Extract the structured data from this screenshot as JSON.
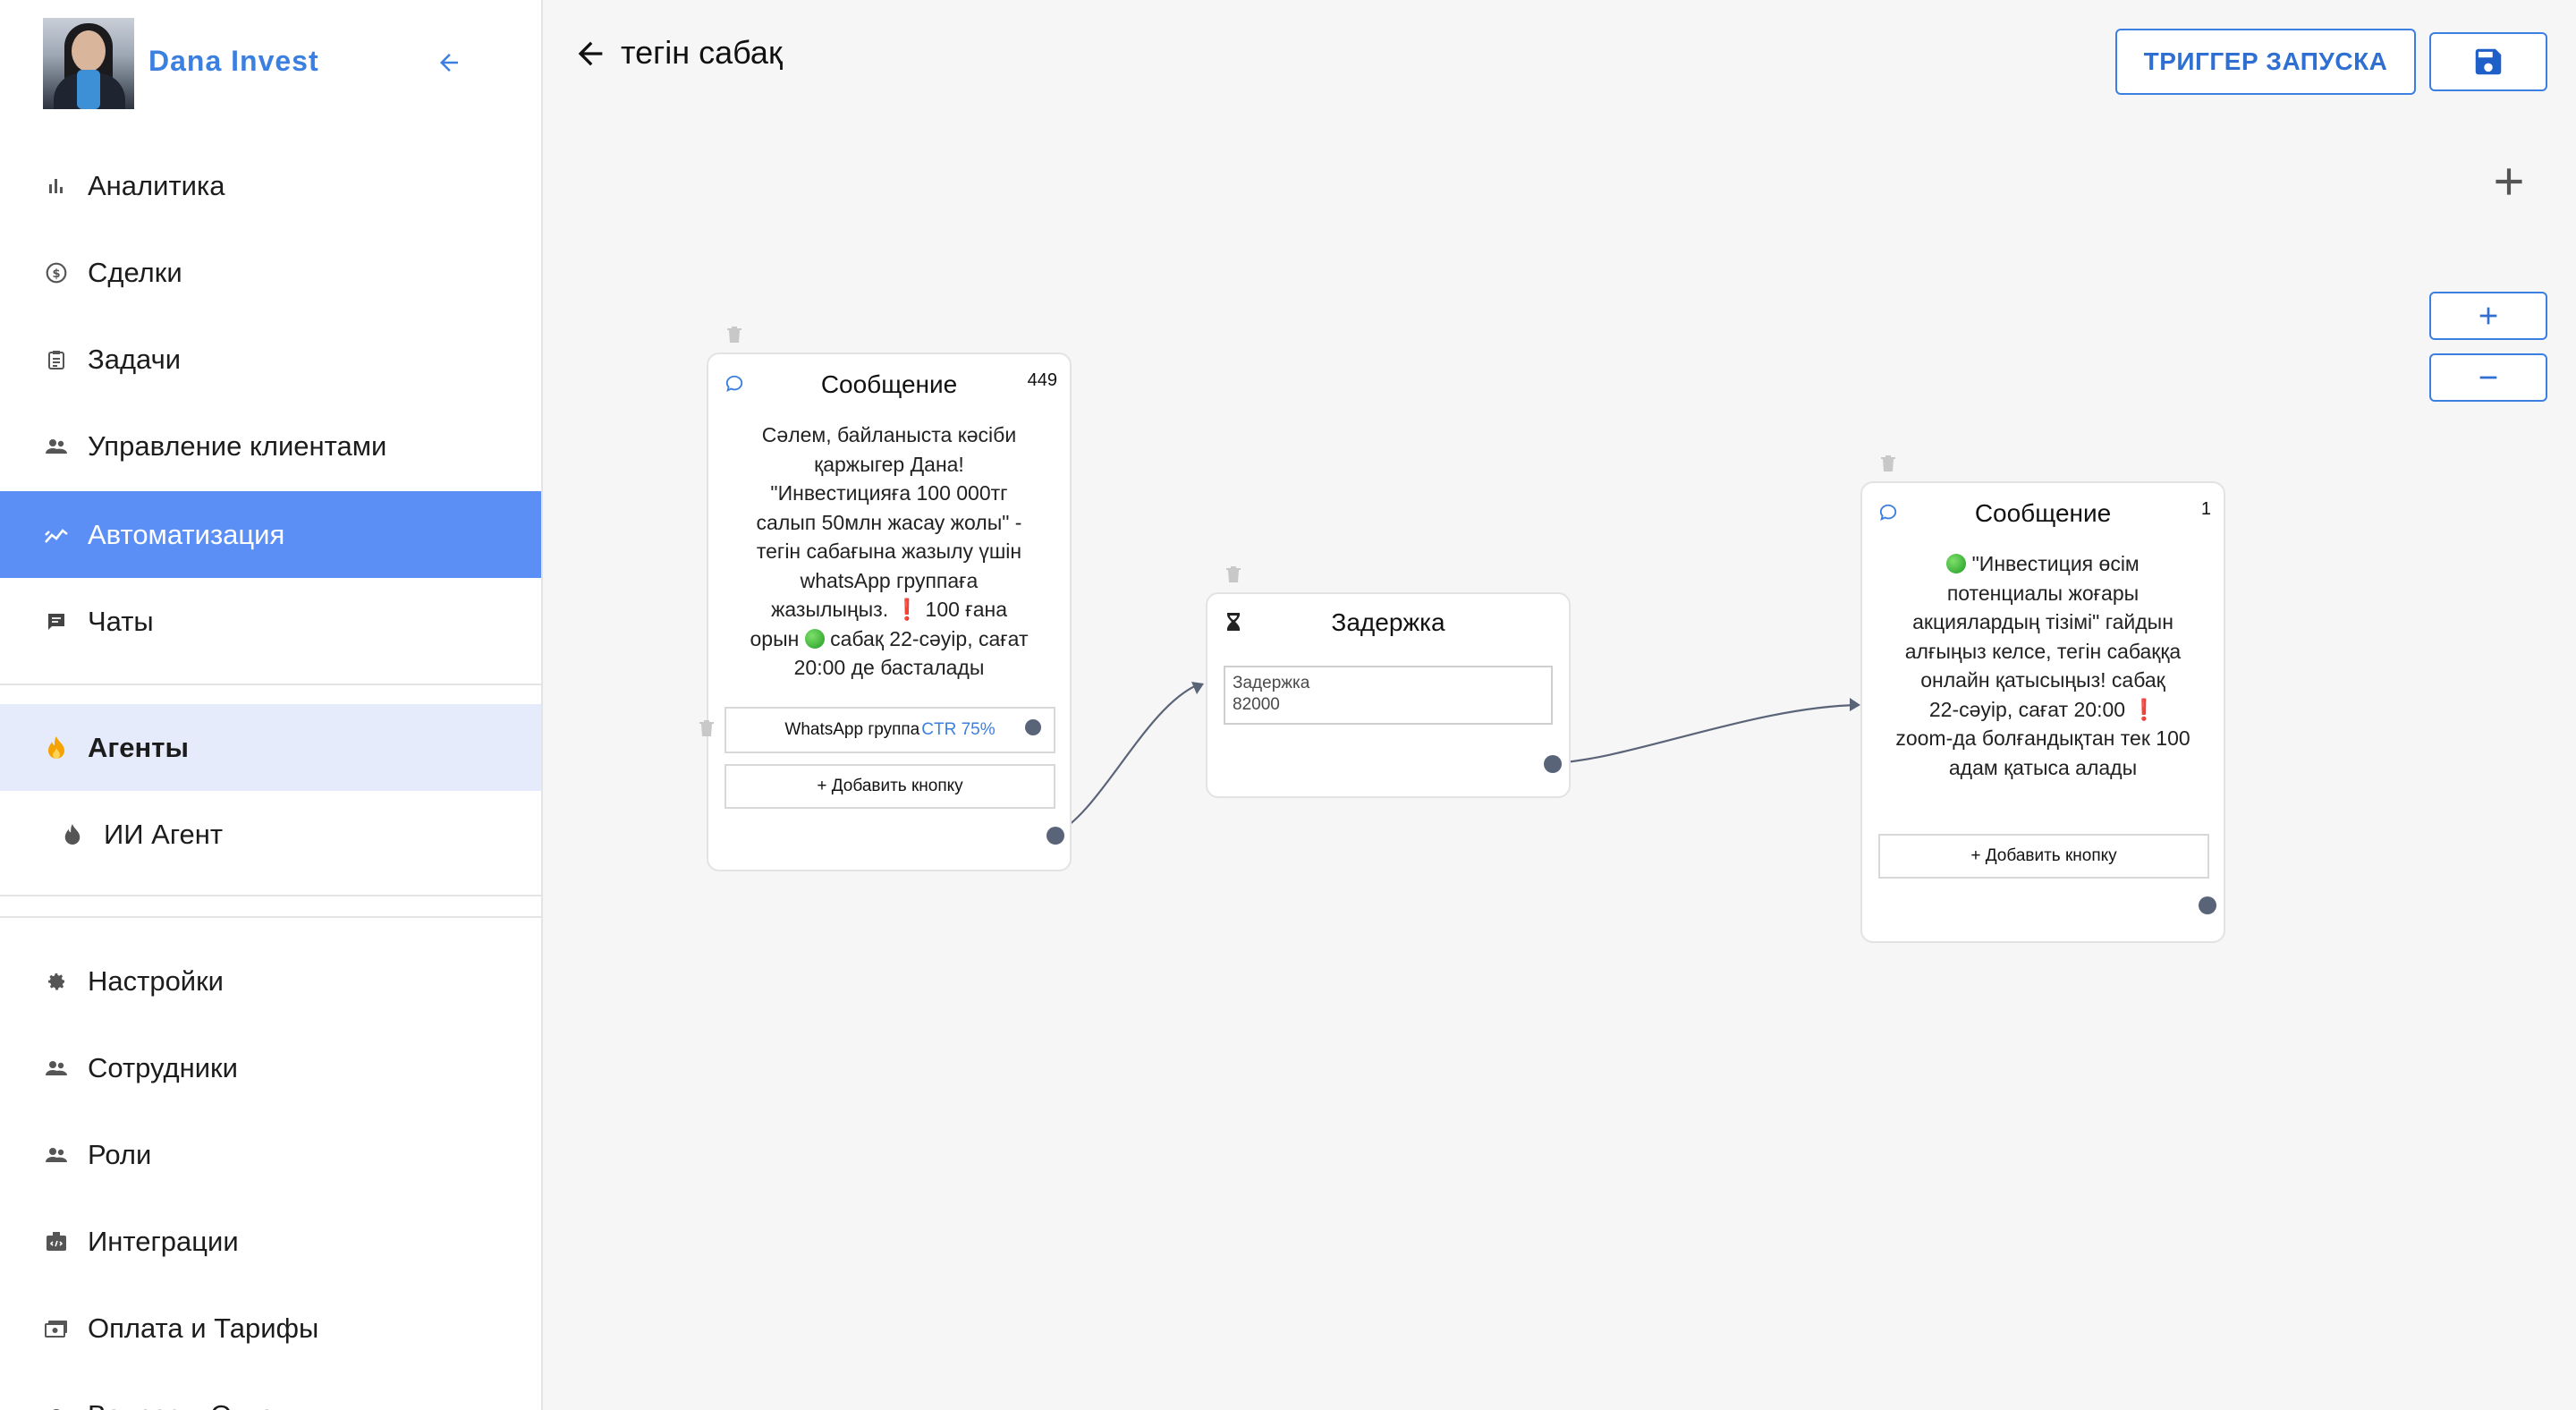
{
  "sidebar": {
    "brand": "Dana Invest",
    "items": [
      {
        "label": "Аналитика",
        "icon": "bar-chart-icon"
      },
      {
        "label": "Сделки",
        "icon": "dollar-circle-icon"
      },
      {
        "label": "Задачи",
        "icon": "clipboard-icon"
      },
      {
        "label": "Управление клиентами",
        "icon": "people-icon"
      },
      {
        "label": "Автоматизация",
        "icon": "trend-icon"
      },
      {
        "label": "Чаты",
        "icon": "chat-icon"
      }
    ],
    "agents": {
      "label": "Агенты",
      "icon": "fire-icon"
    },
    "ai_agent": {
      "label": "ИИ Агент",
      "icon": "flame-icon"
    },
    "bottom_items": [
      {
        "label": "Настройки",
        "icon": "gear-icon"
      },
      {
        "label": "Сотрудники",
        "icon": "people-icon"
      },
      {
        "label": "Роли",
        "icon": "people-icon"
      },
      {
        "label": "Интеграции",
        "icon": "integration-icon"
      },
      {
        "label": "Оплата и Тарифы",
        "icon": "payment-icon"
      },
      {
        "label": "Вопросы-Ответы",
        "icon": "gear-icon"
      }
    ]
  },
  "header": {
    "title": "тегін сабақ",
    "trigger_label": "ТРИГГЕР ЗАПУСКА"
  },
  "colors": {
    "accent": "#3b7fe0",
    "active_bg": "#5b8ff5",
    "selected_bg": "#e5ebfb"
  },
  "nodes": {
    "msg1": {
      "title": "Сообщение",
      "count": "449",
      "text_lines": [
        "Сәлем, байланыста кәсіби",
        "қаржыгер Дана!",
        "\"Инвестицияға 100 000тг",
        "салып  50млн жасау жолы\" -",
        "тегін сабағына жазылу үшін",
        "whatsApp группаға"
      ],
      "line7a": "жазылыңыз.",
      "line7b": "100 ғана",
      "line8a": "орын",
      "line8b": "сабақ 22-сәуір, сағат",
      "line9": "20:00 де басталады",
      "button_label": "WhatsApp группа",
      "button_ctr": "CTR 75%",
      "add_button": "+ Добавить кнопку"
    },
    "delay": {
      "title": "Задержка",
      "field_label": "Задержка",
      "field_value": "82000"
    },
    "msg2": {
      "title": "Сообщение",
      "count": "1",
      "line1": "\"Инвестиция өсім",
      "text_lines": [
        "потенциалы жоғары",
        "акциялардың тізімі\" гайдын",
        "алғыңыз келсе, тегін сабаққа",
        "онлайн қатысыңыз!   сабақ"
      ],
      "line6": "22-сәуір, сағат 20:00",
      "text_lines2": [
        "zoom-да болғандықтан тек 100",
        "адам қатыса алады"
      ],
      "add_button": "+ Добавить кнопку"
    }
  }
}
